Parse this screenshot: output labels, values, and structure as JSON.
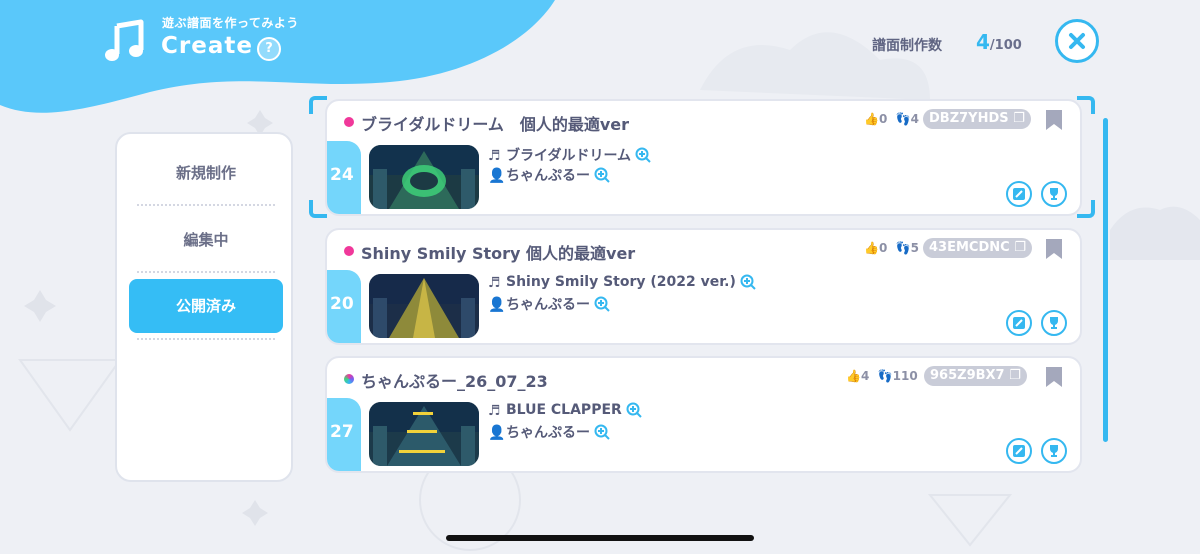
{
  "header": {
    "subtitle": "遊ぶ譜面を作ってみよう",
    "title": "Create",
    "help_symbol": "?",
    "count_label": "譜面制作数",
    "count_value": "4",
    "count_max": "/100"
  },
  "sidebar": {
    "items": [
      {
        "label": "新規制作"
      },
      {
        "label": "編集中"
      },
      {
        "label": "公開済み"
      }
    ]
  },
  "cards": [
    {
      "title": "ブライダルドリーム　個人的最適ver",
      "dot_color": "#f0389a",
      "likes": "0",
      "plays": "4",
      "code": "DBZ7YHDS",
      "level": "24",
      "song": "ブライダルドリーム",
      "author": "ちゃんぷるー",
      "thumb_color": "#3fd67b"
    },
    {
      "title": "Shiny Smily Story 個人的最適ver",
      "dot_color": "#f0389a",
      "likes": "0",
      "plays": "5",
      "code": "43EMCDNC",
      "level": "20",
      "song": "Shiny Smily Story (2022 ver.)",
      "author": "ちゃんぷるー",
      "thumb_color": "#e0c84a"
    },
    {
      "title": "ちゃんぷるー_26_07_23",
      "dot_color": "#7b5cf0",
      "likes": "4",
      "plays": "110",
      "code": "965Z9BX7",
      "level": "27",
      "song": "BLUE CLAPPER",
      "author": "ちゃんぷるー",
      "thumb_color": "#f2d23a"
    }
  ],
  "colors": {
    "accent": "#35b8f0",
    "header": "#5ac8fa",
    "level_tab": "#74d6fb"
  }
}
